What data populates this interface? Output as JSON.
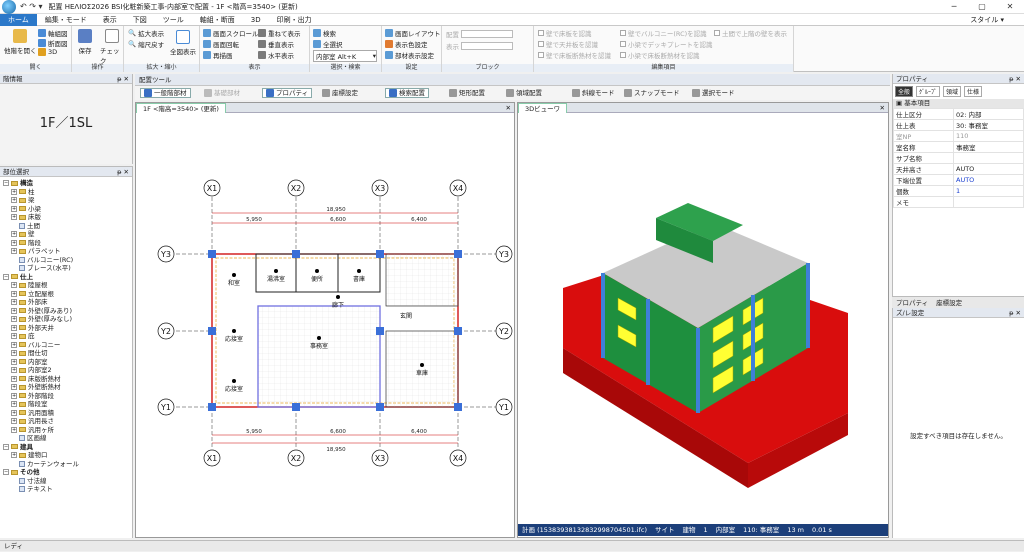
{
  "app": {
    "title": "配置 HEΛIOΣ2026 BSI化粧新築工事-内部室で配置 - 1F <階高=3540> (更新)",
    "quick_access": "↶ ↷ ▾",
    "window_buttons": [
      "─",
      "▢",
      "✕"
    ]
  },
  "menu": {
    "items": [
      "ホーム",
      "編集・モード",
      "表示",
      "下図",
      "ツール",
      "軸組・断面",
      "3D",
      "印刷・出力"
    ],
    "active": "ホーム",
    "style_label": "スタイル ▾"
  },
  "ribbon": {
    "open": {
      "big": "他階を開く",
      "items": [
        "軸組図",
        "断面図",
        "3D"
      ],
      "label": "開く"
    },
    "operate": {
      "save": "保存",
      "check": "チェック",
      "label": "操作"
    },
    "zoom": {
      "items": [
        "拡大表示",
        "縮尺戻す"
      ],
      "full": "全図表示",
      "label": "拡大・縮小"
    },
    "display": {
      "col1": [
        "画面スクロール",
        "画面回転",
        "再描画"
      ],
      "col2": [
        "重ねて表示",
        "垂直表示",
        "水平表示"
      ],
      "label": "表示"
    },
    "select": {
      "items": [
        "検索",
        "全選択"
      ],
      "dropdown": "内部室 Alt+K",
      "label": "選択・検索"
    },
    "settings": {
      "items": [
        "画面レイアウト",
        "表示色設定",
        "部材表示設定"
      ],
      "label": "設定"
    },
    "block": {
      "items": [
        "配置",
        "表示"
      ],
      "label": "ブロック"
    },
    "edit": {
      "col1": [
        "壁で床板を認識",
        "壁で天井板を認識",
        "壁で床板断熱材を認識"
      ],
      "col2": [
        "壁でバルコニー(RC)を認識",
        "小梁でデッキプレートを認識",
        "小梁で床板断熱材を認識"
      ],
      "col3": [
        "土間で上階の壁を表示"
      ],
      "label": "編集項目"
    }
  },
  "left": {
    "floor_panel_title": "階情報",
    "floor_label": "1F／1SL",
    "tree_title": "部位選択",
    "tree": [
      {
        "t": "構造",
        "d": 0,
        "type": "folder",
        "bold": true
      },
      {
        "t": "柱",
        "d": 1,
        "type": "folder"
      },
      {
        "t": "梁",
        "d": 1,
        "type": "folder"
      },
      {
        "t": "小梁",
        "d": 1,
        "type": "folder"
      },
      {
        "t": "床版",
        "d": 1,
        "type": "folder"
      },
      {
        "t": "土間",
        "d": 1,
        "type": "leaf"
      },
      {
        "t": "壁",
        "d": 1,
        "type": "folder"
      },
      {
        "t": "階段",
        "d": 1,
        "type": "folder"
      },
      {
        "t": "パラペット",
        "d": 1,
        "type": "folder"
      },
      {
        "t": "バルコニー(RC)",
        "d": 1,
        "type": "leaf"
      },
      {
        "t": "ブレース(水平)",
        "d": 1,
        "type": "leaf"
      },
      {
        "t": "仕上",
        "d": 0,
        "type": "folder",
        "bold": true
      },
      {
        "t": "陸屋根",
        "d": 1,
        "type": "folder"
      },
      {
        "t": "立配屋根",
        "d": 1,
        "type": "folder"
      },
      {
        "t": "外部床",
        "d": 1,
        "type": "folder"
      },
      {
        "t": "外壁(厚みあり)",
        "d": 1,
        "type": "folder"
      },
      {
        "t": "外壁(厚みなし)",
        "d": 1,
        "type": "folder"
      },
      {
        "t": "外部天井",
        "d": 1,
        "type": "folder"
      },
      {
        "t": "庇",
        "d": 1,
        "type": "folder"
      },
      {
        "t": "バルコニー",
        "d": 1,
        "type": "folder"
      },
      {
        "t": "間仕切",
        "d": 1,
        "type": "folder"
      },
      {
        "t": "内部室",
        "d": 1,
        "type": "folder"
      },
      {
        "t": "内部室2",
        "d": 1,
        "type": "folder"
      },
      {
        "t": "床版断熱材",
        "d": 1,
        "type": "folder"
      },
      {
        "t": "外壁断熱材",
        "d": 1,
        "type": "folder"
      },
      {
        "t": "外部階段",
        "d": 1,
        "type": "folder"
      },
      {
        "t": "階段室",
        "d": 1,
        "type": "folder"
      },
      {
        "t": "汎用面積",
        "d": 1,
        "type": "folder"
      },
      {
        "t": "汎用長さ",
        "d": 1,
        "type": "folder"
      },
      {
        "t": "汎用ヶ所",
        "d": 1,
        "type": "folder"
      },
      {
        "t": "区画線",
        "d": 1,
        "type": "leaf"
      },
      {
        "t": "建具",
        "d": 0,
        "type": "folder",
        "bold": true
      },
      {
        "t": "建物口",
        "d": 1,
        "type": "folder"
      },
      {
        "t": "カーテンウォール",
        "d": 1,
        "type": "leaf"
      },
      {
        "t": "その他",
        "d": 0,
        "type": "folder",
        "bold": true
      },
      {
        "t": "寸法線",
        "d": 1,
        "type": "leaf"
      },
      {
        "t": "テキスト",
        "d": 1,
        "type": "leaf"
      }
    ]
  },
  "tools": {
    "title": "配置ツール",
    "buttons": [
      "一般階部材",
      "基礎部材",
      "プロパティ",
      "座標設定",
      "検索配置",
      "矩形配置",
      "領域配置",
      "斜線モード",
      "スナップモード",
      "選択モード"
    ],
    "active": [
      0,
      2,
      4
    ],
    "disabled": [
      1
    ]
  },
  "plan": {
    "tab": "1F <階高=3540> (更新)",
    "axes_x": [
      "X1",
      "X2",
      "X3",
      "X4"
    ],
    "axes_y": [
      "Y3",
      "Y2",
      "Y1"
    ],
    "dims": [
      "18,950",
      "5,950",
      "6,600",
      "6,400"
    ],
    "rooms": [
      "和室",
      "湯沸室",
      "便所",
      "書庫",
      "廊下",
      "玄関",
      "応接室",
      "事務室",
      "応接室",
      "車庫"
    ]
  },
  "view3d": {
    "tab": "3Dビューワ",
    "status": [
      "計画 (15383938132832998704501.ifc)",
      "サイト",
      "建物",
      "1",
      "内部室",
      "110: 事務室",
      "13 m",
      "0.01 s"
    ]
  },
  "properties": {
    "title": "プロパティ",
    "tabs": [
      "全般",
      "ｸﾞﾙｰﾌﾟ",
      "領域",
      "仕様"
    ],
    "section": "基本項目",
    "rows": [
      {
        "k": "仕上区分",
        "v": "02: 内部"
      },
      {
        "k": "仕上表",
        "v": "30: 事務室"
      },
      {
        "k": "室NP",
        "v": "110",
        "gray": true
      },
      {
        "k": "室名称",
        "v": "事務室"
      },
      {
        "k": "サブ名称",
        "v": ""
      },
      {
        "k": "天井高さ",
        "v": "AUTO"
      },
      {
        "k": "下端位置",
        "v": "AUTO",
        "blue": true
      },
      {
        "k": "個数",
        "v": "1",
        "blue": true
      },
      {
        "k": "メモ",
        "v": ""
      }
    ],
    "bottom_tabs": [
      "プロパティ",
      "座標設定"
    ],
    "snap_title": "ズ/レ設定",
    "snap_msg": "設定すべき項目は存在しません。"
  },
  "statusbar": {
    "text": "レディ"
  },
  "colors": {
    "accent": "#2b78c9",
    "roof": "#1fa34a",
    "base": "#e01010",
    "column": "#3f7fd8",
    "window": "#ffff33"
  }
}
